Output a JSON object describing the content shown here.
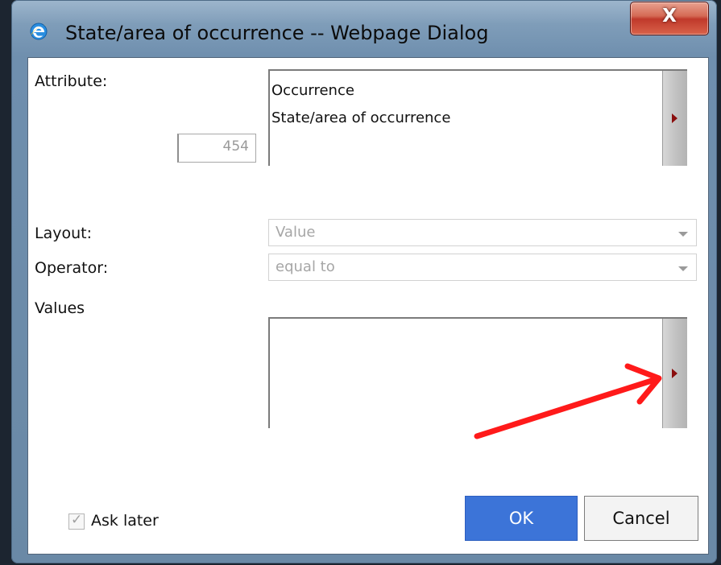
{
  "window": {
    "title": "State/area of occurrence -- Webpage Dialog",
    "close_label": "X"
  },
  "attribute": {
    "label": "Attribute:",
    "id_value": "454",
    "lines": [
      "Occurrence",
      "State/area of occurrence"
    ]
  },
  "layout": {
    "label": "Layout:",
    "value": "Value"
  },
  "operator": {
    "label": "Operator:",
    "value": "equal to"
  },
  "values": {
    "label": "Values"
  },
  "footer": {
    "ask_later_label": "Ask later",
    "ask_later_checked": true,
    "ok_label": "OK",
    "cancel_label": "Cancel"
  },
  "colors": {
    "ok_button": "#3c74d8",
    "annotation_arrow": "#ff1a1a",
    "expand_arrow": "#8a0d0d"
  },
  "icons": {
    "app": "internet-explorer-icon",
    "expand": "triangle-right-icon",
    "dropdown": "chevron-down-icon",
    "check": "check-icon"
  }
}
